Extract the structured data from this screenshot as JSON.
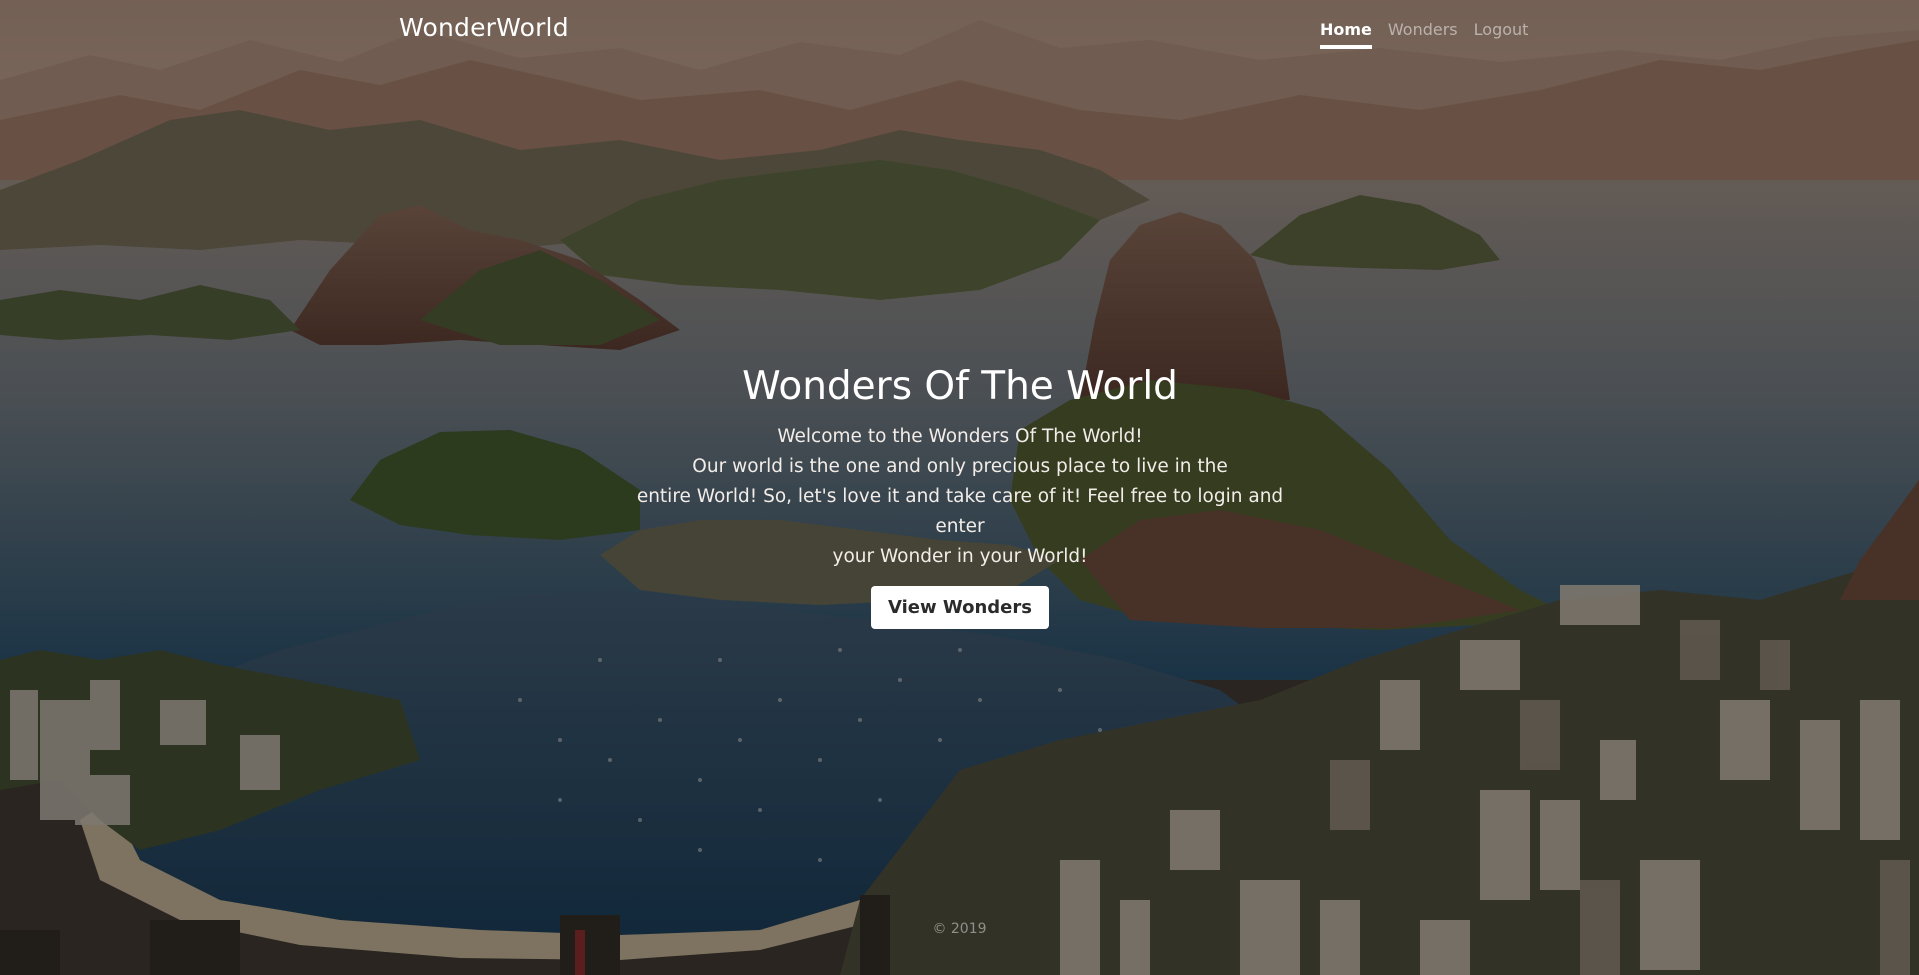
{
  "brand": "WonderWorld",
  "nav": {
    "items": [
      {
        "label": "Home",
        "active": true
      },
      {
        "label": "Wonders",
        "active": false
      },
      {
        "label": "Logout",
        "active": false
      }
    ]
  },
  "hero": {
    "title": "Wonders Of The World",
    "lines": [
      "Welcome to the Wonders Of The World!",
      "Our world is the one and only precious place to live in the",
      "entire World! So, let's love it and take care of it! Feel free to login and enter",
      "your Wonder in your World!"
    ],
    "button_label": "View Wonders"
  },
  "footer": {
    "text": "© 2019"
  },
  "colors": {
    "overlay": "#14100c",
    "button_bg": "#ffffff",
    "text": "#ffffff"
  }
}
